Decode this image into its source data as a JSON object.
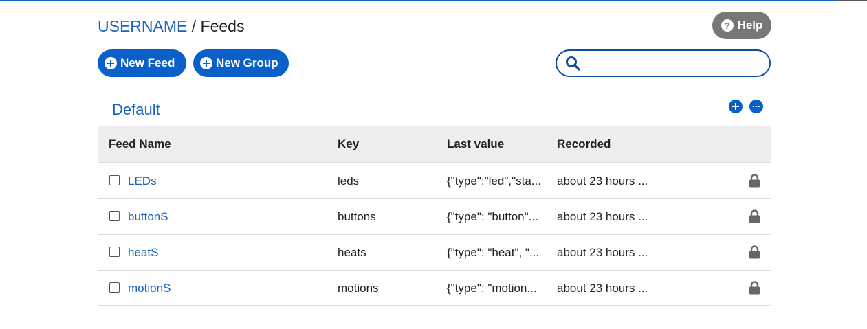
{
  "breadcrumb": {
    "user": "USERNAME",
    "separator": "/",
    "page": "Feeds"
  },
  "help_button": {
    "icon": "question-icon",
    "glyph": "?",
    "label": "Help"
  },
  "actions": {
    "new_feed": {
      "icon": "plus-circle-icon",
      "label": "New Feed"
    },
    "new_group": {
      "icon": "plus-circle-icon",
      "label": "New Group"
    }
  },
  "search": {
    "icon": "search-icon",
    "value": "",
    "placeholder": ""
  },
  "group": {
    "title": "Default",
    "add_icon": "plus-circle-icon",
    "more_icon": "ellipsis-circle-icon"
  },
  "table": {
    "headers": {
      "feed_name": "Feed Name",
      "key": "Key",
      "last_value": "Last value",
      "recorded": "Recorded"
    },
    "rows": [
      {
        "name": "LEDs",
        "key": "leds",
        "last_value": "{\"type\":\"led\",\"sta...",
        "recorded": "about 23 hours ...",
        "checked": false,
        "icon": "lock-icon"
      },
      {
        "name": "buttonS",
        "key": "buttons",
        "last_value": "{\"type\": \"button\"...",
        "recorded": "about 23 hours ...",
        "checked": false,
        "icon": "lock-icon"
      },
      {
        "name": "heatS",
        "key": "heats",
        "last_value": "{\"type\": \"heat\", \"...",
        "recorded": "about 23 hours ...",
        "checked": false,
        "icon": "lock-icon"
      },
      {
        "name": "motionS",
        "key": "motions",
        "last_value": "{\"type\": \"motion...",
        "recorded": "about 23 hours ...",
        "checked": false,
        "icon": "lock-icon"
      }
    ]
  },
  "colors": {
    "accent": "#0b5fc9",
    "link": "#1a63c0",
    "help_bg": "#777777",
    "header_bg": "#eeeeee",
    "lock": "#666666"
  }
}
